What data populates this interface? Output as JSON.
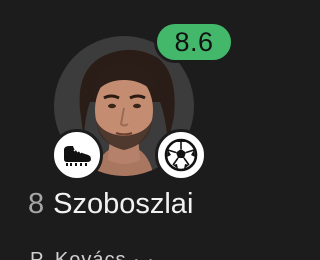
{
  "player": {
    "number": "8",
    "name": "Szoboszlai",
    "rating": "8.6",
    "rating_color": "#44b86a"
  },
  "events": {
    "assist_icon": "football-boot-icon",
    "goal_icon": "football-icon"
  },
  "next_row_partial": "P. Kovács · ·"
}
